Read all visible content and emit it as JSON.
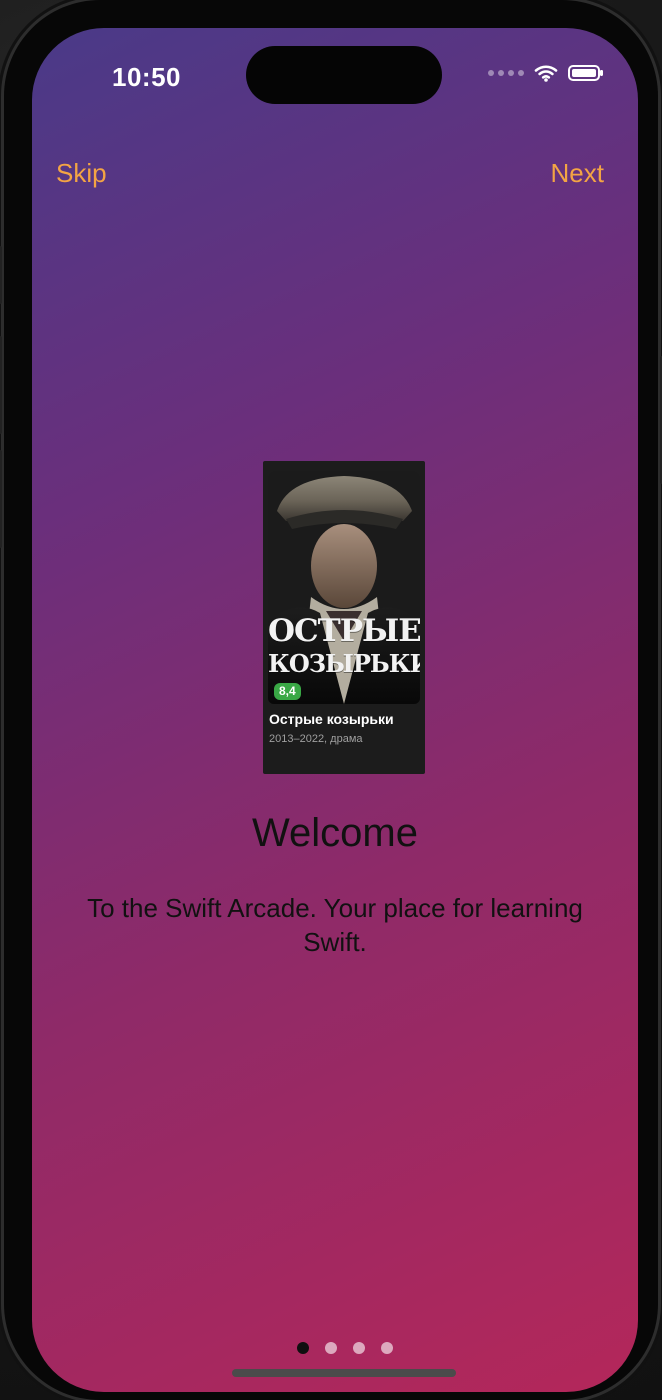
{
  "status_bar": {
    "time": "10:50"
  },
  "navigation": {
    "skip_label": "Skip",
    "next_label": "Next"
  },
  "card": {
    "poster_title_line1": "ОСТРЫЕ",
    "poster_title_line2": "КОЗЫРЬКИ",
    "rating": "8,4",
    "title": "Острые козырьки",
    "meta": "2013–2022, драма"
  },
  "onboarding": {
    "title": "Welcome",
    "subtitle": "To the Swift Arcade. Your place for learning Swift."
  },
  "pager": {
    "total_pages": 4,
    "active_page": 1
  },
  "colors": {
    "accent": "#f3a444",
    "rating_badge": "#39a845",
    "gradient_start": "#4a3a88",
    "gradient_end": "#b4275a"
  },
  "icons": {
    "wifi": "wifi-icon",
    "battery": "battery-icon",
    "signal": "signal-icon"
  }
}
